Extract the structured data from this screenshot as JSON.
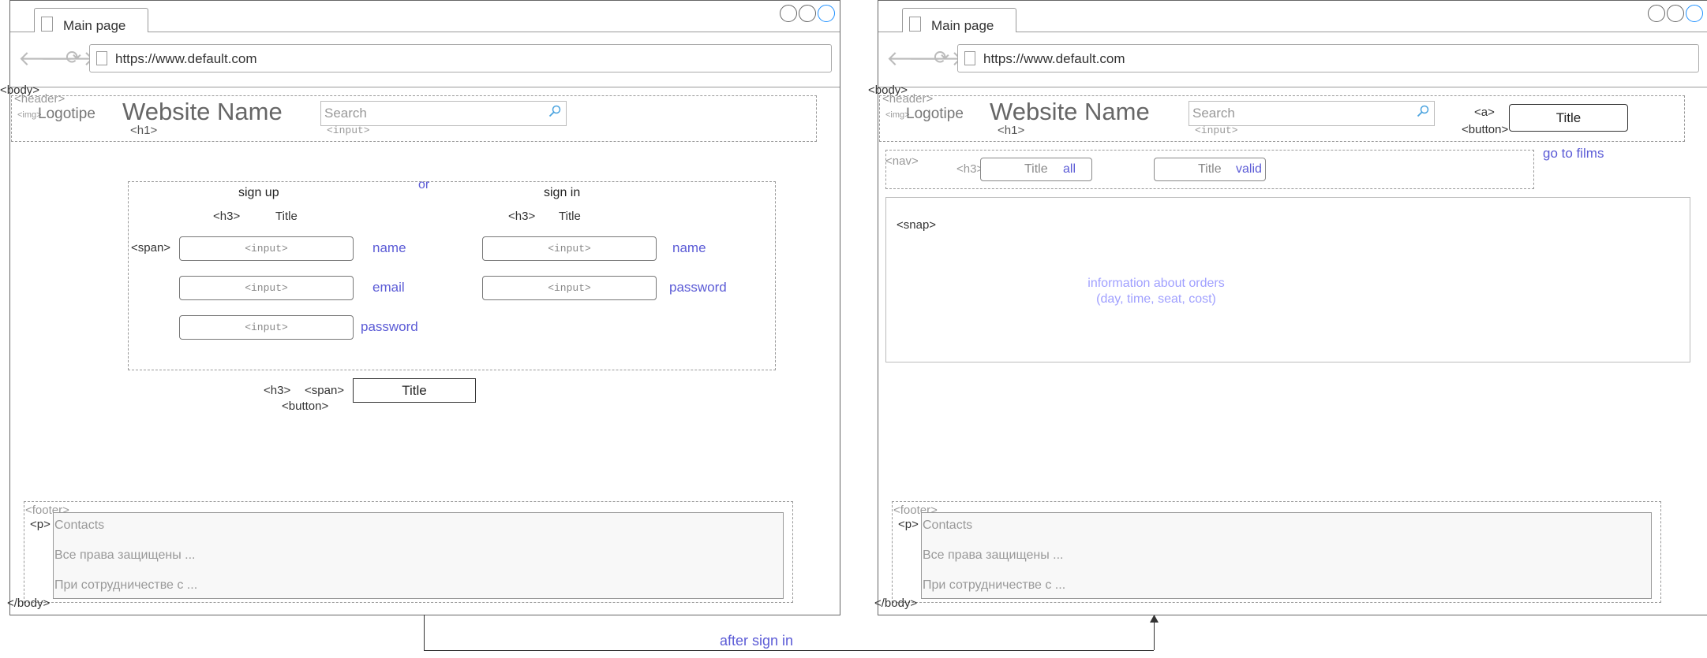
{
  "windows": [
    {
      "tab_title": "Main page",
      "url": "https://www.default.com",
      "body_open": "<body>",
      "body_close": "</body>",
      "header_tag": "<header>",
      "img_tag": "<img>",
      "logo": "Logotipe",
      "site_name": "Website Name",
      "h1_tag": "<h1>",
      "search_placeholder": "Search",
      "input_tag": "<input>",
      "footer_tag": "<footer>",
      "p_tag": "<p>",
      "footer_lines": [
        "Contacts",
        "Все права защищены ...",
        "При сотрудничестве с ..."
      ]
    },
    {
      "tab_title": "Main page",
      "url": "https://www.default.com",
      "body_open": "<body>",
      "body_close": "</body>",
      "header_tag": "<header>",
      "img_tag": "<img>",
      "logo": "Logotipe",
      "site_name": "Website Name",
      "h1_tag": "<h1>",
      "search_placeholder": "Search",
      "input_tag": "<input>",
      "footer_tag": "<footer>",
      "p_tag": "<p>",
      "footer_lines": [
        "Contacts",
        "Все права защищены ...",
        "При сотрудничестве с ..."
      ]
    }
  ],
  "auth": {
    "or_label": "or",
    "signup": {
      "heading": "sign up",
      "h3_tag": "<h3>",
      "title": "Title",
      "span_tag": "<span>",
      "fields": [
        {
          "input": "<input>",
          "label": "name"
        },
        {
          "input": "<input>",
          "label": "email"
        },
        {
          "input": "<input>",
          "label": "password"
        }
      ]
    },
    "signin": {
      "heading": "sign in",
      "h3_tag": "<h3>",
      "title": "Title",
      "fields": [
        {
          "input": "<input>",
          "label": "name"
        },
        {
          "input": "<input>",
          "label": "password"
        }
      ]
    },
    "submit": {
      "h3_tag": "<h3>",
      "span_tag": "<span>",
      "button_tag": "<button>",
      "button_title": "Title"
    }
  },
  "account": {
    "a_tag": "<a>",
    "button_tag": "<button>",
    "header_button": "Title",
    "nav_tag": "<nav>",
    "h3_tag": "<h3>",
    "filters": [
      {
        "title": "Title",
        "value": "all"
      },
      {
        "title": "Title",
        "value": "valid"
      }
    ],
    "go_to_films": "go to films",
    "snap_tag": "<snap>",
    "info_line1": "information about orders",
    "info_line2": "(day, time, seat, cost)"
  },
  "connector": {
    "label": "after sign in"
  }
}
